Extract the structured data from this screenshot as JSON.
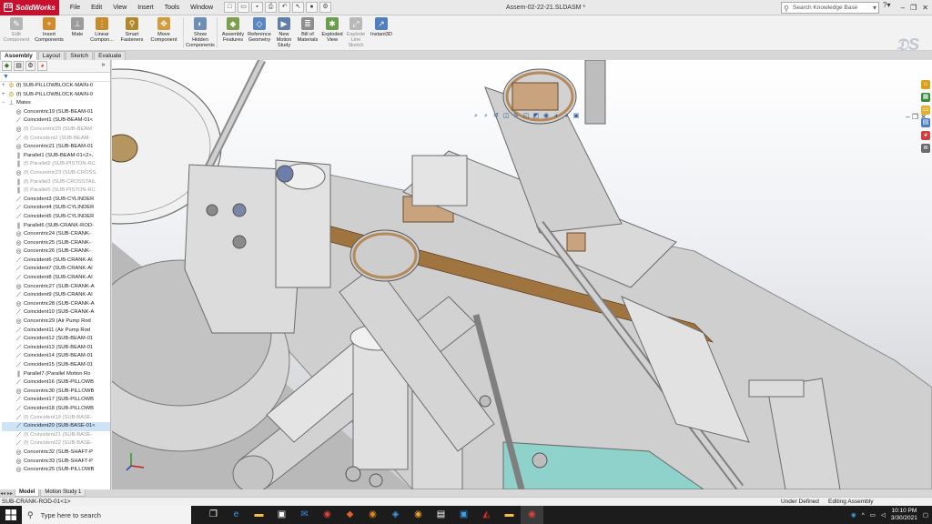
{
  "app": {
    "logo_text": "SolidWorks",
    "brand_color": "#c8102e",
    "doc_title": "Assem-02-22-21.SLDASM *"
  },
  "menu": [
    "File",
    "Edit",
    "View",
    "Insert",
    "Tools",
    "Window"
  ],
  "search": {
    "placeholder": "Search Knowledge Base"
  },
  "ribbon": [
    {
      "label": "Edit Component",
      "icon": "edit-component-icon",
      "dim": true
    },
    {
      "label": "Insert Components",
      "icon": "insert-components-icon"
    },
    {
      "label": "Mate",
      "icon": "mate-icon"
    },
    {
      "label": "Linear Compon...",
      "icon": "linear-pattern-icon"
    },
    {
      "label": "Smart Fasteners",
      "icon": "smart-fasteners-icon"
    },
    {
      "label": "Move Component",
      "icon": "move-component-icon"
    },
    {
      "label": "Show Hidden Components",
      "icon": "show-hidden-icon"
    },
    {
      "label": "Assembly Features",
      "icon": "assembly-features-icon"
    },
    {
      "label": "Reference Geometry",
      "icon": "reference-geometry-icon"
    },
    {
      "label": "New Motion Study",
      "icon": "motion-study-icon"
    },
    {
      "label": "Bill of Materials",
      "icon": "bom-icon"
    },
    {
      "label": "Exploded View",
      "icon": "exploded-view-icon"
    },
    {
      "label": "Explode Line Sketch",
      "icon": "explode-line-icon",
      "dim": true
    },
    {
      "label": "Instant3D",
      "icon": "instant3d-icon"
    }
  ],
  "command_tabs": [
    "Assembly",
    "Layout",
    "Sketch",
    "Evaluate"
  ],
  "tree": {
    "top": [
      {
        "label": "(f) SUB-PILLOWBLOCK-MAIN-0",
        "type": "part"
      },
      {
        "label": "(f) SUB-PILLOWBLOCK-MAIN-0",
        "type": "part"
      },
      {
        "label": "Mates",
        "type": "folder"
      }
    ],
    "mates": [
      {
        "label": "Concentric19 (SUB-BEAM-01",
        "type": "concentric"
      },
      {
        "label": "Coincident1 (SUB-BEAM-01<",
        "type": "coincident"
      },
      {
        "label": "(f) Concentric20 (SUB-BEAM",
        "type": "concentric",
        "suppressed": true
      },
      {
        "label": "(f) Coincident2 (SUB-BEAM-",
        "type": "coincident",
        "suppressed": true
      },
      {
        "label": "Concentric21 (SUB-BEAM-01",
        "type": "concentric"
      },
      {
        "label": "Parallel1 (SUB-BEAM-01<2>,",
        "type": "parallel"
      },
      {
        "label": "(f) Parallel2 (SUB-PISTON-RC",
        "type": "parallel",
        "suppressed": true
      },
      {
        "label": "(f) Concentric23 (SUB-CROSS",
        "type": "concentric",
        "suppressed": true
      },
      {
        "label": "(f) Parallel3 (SUB-CROSSTAIL",
        "type": "parallel",
        "suppressed": true
      },
      {
        "label": "(f) Parallel5 (SUB-PISTON-RC",
        "type": "parallel",
        "suppressed": true
      },
      {
        "label": "Coincident3 (SUB-CYLINDER",
        "type": "coincident"
      },
      {
        "label": "Coincident4 (SUB-CYLINDER",
        "type": "coincident"
      },
      {
        "label": "Coincident5 (SUB-CYLINDER",
        "type": "coincident"
      },
      {
        "label": "Parallel6 (SUB-CRANK-ROD-",
        "type": "parallel"
      },
      {
        "label": "Concentric24 (SUB-CRANK-",
        "type": "concentric"
      },
      {
        "label": "Concentric25 (SUB-CRANK-",
        "type": "concentric"
      },
      {
        "label": "Concentric26 (SUB-CRANK-",
        "type": "concentric"
      },
      {
        "label": "Coincident6 (SUB-CRANK-AI",
        "type": "coincident"
      },
      {
        "label": "Coincident7 (SUB-CRANK-AI",
        "type": "coincident"
      },
      {
        "label": "Coincident8 (SUB-CRANK-AI",
        "type": "coincident"
      },
      {
        "label": "Concentric27 (SUB-CRANK-A",
        "type": "concentric"
      },
      {
        "label": "Coincident9 (SUB-CRANK-AI",
        "type": "coincident"
      },
      {
        "label": "Concentric28 (SUB-CRANK-A",
        "type": "concentric"
      },
      {
        "label": "Coincident10 (SUB-CRANK-A",
        "type": "coincident"
      },
      {
        "label": "Concentric29 (Air Pump Rod",
        "type": "concentric"
      },
      {
        "label": "Coincident11 (Air Pump Rod",
        "type": "coincident"
      },
      {
        "label": "Coincident12 (SUB-BEAM-01",
        "type": "coincident"
      },
      {
        "label": "Coincident13 (SUB-BEAM-01",
        "type": "coincident"
      },
      {
        "label": "Coincident14 (SUB-BEAM-01",
        "type": "coincident"
      },
      {
        "label": "Coincident15 (SUB-BEAM-01",
        "type": "coincident"
      },
      {
        "label": "Parallel7 (Parallel Motion Ro",
        "type": "parallel"
      },
      {
        "label": "Coincident16 (SUB-PILLOWB",
        "type": "coincident"
      },
      {
        "label": "Concentric30 (SUB-PILLOWB",
        "type": "concentric"
      },
      {
        "label": "Coincident17 (SUB-PILLOWB",
        "type": "coincident"
      },
      {
        "label": "Coincident18 (SUB-PILLOWB",
        "type": "coincident"
      },
      {
        "label": "(f) Coincident19 (SUB-BASE-",
        "type": "coincident",
        "suppressed": true
      },
      {
        "label": "Coincident20 (SUB-BASE-01<",
        "type": "coincident",
        "selected": true
      },
      {
        "label": "(f) Coincident21 (SUB-BASE-",
        "type": "coincident",
        "suppressed": true
      },
      {
        "label": "(f) Coincident22 (SUB-BASE-",
        "type": "coincident",
        "suppressed": true
      },
      {
        "label": "Concentric32 (SUB-SHAFT-P",
        "type": "concentric"
      },
      {
        "label": "Concentric33 (SUB-SHAFT-P",
        "type": "concentric"
      },
      {
        "label": "Concentric25 (SUB-PILLOWB",
        "type": "concentric"
      }
    ]
  },
  "bottom_tabs": [
    "Model",
    "Motion Study 1"
  ],
  "status": {
    "left": "SUB-CRANK-ROD-01<1>",
    "definition": "Under Defined",
    "mode": "Editing Assembly"
  },
  "taskbar": {
    "search_placeholder": "Type here to search",
    "time": "10:10 PM",
    "date": "3/30/2021"
  },
  "colors": {
    "bronze": "#c9a27e",
    "steel": "#cfcfcf",
    "water": "#8fd2cc"
  }
}
